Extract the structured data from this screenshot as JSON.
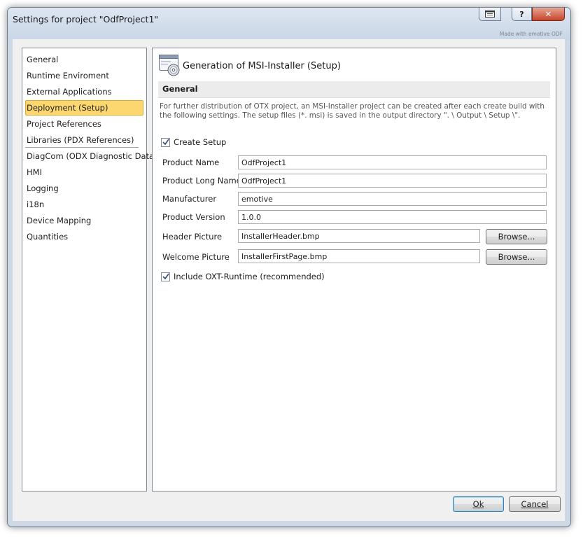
{
  "window": {
    "title": "Settings for project \"OdfProject1\"",
    "brand": "Made with emotive ODF"
  },
  "titlebar_buttons": {
    "help": "?",
    "close": "✕"
  },
  "nav": {
    "items": [
      "General",
      "Runtime Enviroment",
      "External Applications",
      "Deployment (Setup)",
      "Project References",
      "Libraries (PDX References)",
      "DiagCom (ODX Diagnostic Data)",
      "HMI",
      "Logging",
      "i18n",
      "Device Mapping",
      "Quantities"
    ],
    "selected": "Deployment (Setup)"
  },
  "content": {
    "header_title": "Generation of MSI-Installer (Setup)",
    "section_title": "General",
    "description": "For further distribution of OTX project, an MSI-Installer project can be created after each create build with the following settings. The setup files (*. msi) is saved in the output directory \". \\ Output \\ Setup \\\".",
    "create_setup": {
      "label": "Create Setup",
      "checked": true
    },
    "fields": {
      "product_name": {
        "label": "Product Name",
        "value": "OdfProject1"
      },
      "product_long_name": {
        "label": "Product Long Name",
        "value": "OdfProject1"
      },
      "manufacturer": {
        "label": "Manufacturer",
        "value": "emotive"
      },
      "product_version": {
        "label": "Product Version",
        "value": "1.0.0"
      },
      "header_picture": {
        "label": "Header Picture",
        "value": "InstallerHeader.bmp"
      },
      "welcome_picture": {
        "label": "Welcome Picture",
        "value": "InstallerFirstPage.bmp"
      }
    },
    "browse_label": "Browse...",
    "include_runtime": {
      "label": "Include OXT-Runtime (recommended)",
      "checked": true
    }
  },
  "footer": {
    "ok_label": "Ok",
    "cancel_label": "Cancel"
  },
  "colors": {
    "selection_fill": "#fcd770",
    "selection_border": "#e0a83a",
    "frame": "#cfd9e6",
    "close_button": "#c7442b"
  }
}
